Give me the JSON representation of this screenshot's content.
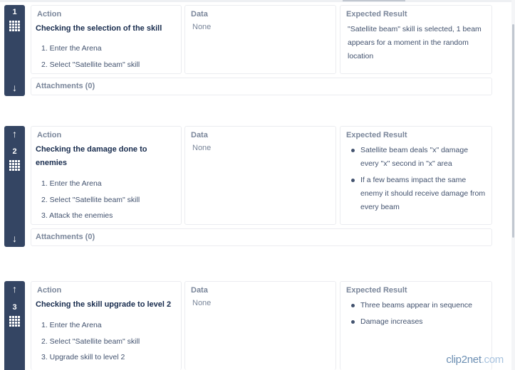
{
  "columns": {
    "action": "Action",
    "data": "Data",
    "expected": "Expected Result"
  },
  "steps": [
    {
      "number": "1",
      "title": "Checking the selection of the skill",
      "actions": [
        "1. Enter the Arena",
        "2. Select \"Satellite beam\" skill"
      ],
      "data": "None",
      "expected_text": "\"Satellite beam\" skill is selected, 1 beam appears for a moment in the random location",
      "attachments": "Attachments (0)"
    },
    {
      "number": "2",
      "title": "Checking the damage done to enemies",
      "actions": [
        "1. Enter the Arena",
        "2. Select \"Satellite beam\" skill",
        "3. Attack the enemies"
      ],
      "data": "None",
      "expected_bullets": [
        "Satellite beam deals \"x\" damage every \"x\" second in \"x\" area",
        "If a few beams impact the same enemy it should receive damage from every beam"
      ],
      "attachments": "Attachments (0)"
    },
    {
      "number": "3",
      "title": "Checking the skill upgrade to level 2",
      "actions": [
        "1. Enter the Arena",
        "2. Select \"Satellite beam\" skill",
        "3. Upgrade skill to level 2"
      ],
      "data": "None",
      "expected_bullets": [
        "Three beams appear in sequence",
        "Damage increases"
      ]
    }
  ],
  "icons": {
    "up": "arrow-up-icon",
    "down": "arrow-down-icon",
    "drag": "drag-handle-icon"
  },
  "colors": {
    "gutter": "#344563",
    "muted": "#7a869a",
    "text": "#172b4d"
  },
  "watermark": {
    "left": "clip",
    "mid": "2",
    "right": "net",
    "suffix": ".com"
  }
}
